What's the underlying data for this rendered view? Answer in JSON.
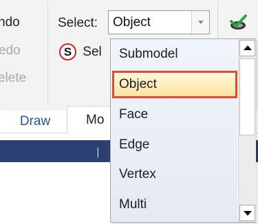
{
  "ribbon": {
    "undo_label": "ndo",
    "redo_label": "edo",
    "delete_label": "elete",
    "select_label": "Select:",
    "select_value": "Object",
    "sel_item_label": "Sel",
    "sel_icon_glyph": "S"
  },
  "tabs": {
    "draw": "Draw",
    "mo": "Mo"
  },
  "panel": {
    "pin_glyph": "❘"
  },
  "dropdown": {
    "options": [
      "Submodel",
      "Object",
      "Face",
      "Edge",
      "Vertex",
      "Multi"
    ],
    "selected": "Object"
  },
  "colors": {
    "accent_tab_text": "#2b5797",
    "selection_border": "#e04a2f",
    "panel_header": "#2c3f73"
  },
  "icons": {
    "green": "green-selection-icon",
    "s": "s-circle-icon"
  }
}
